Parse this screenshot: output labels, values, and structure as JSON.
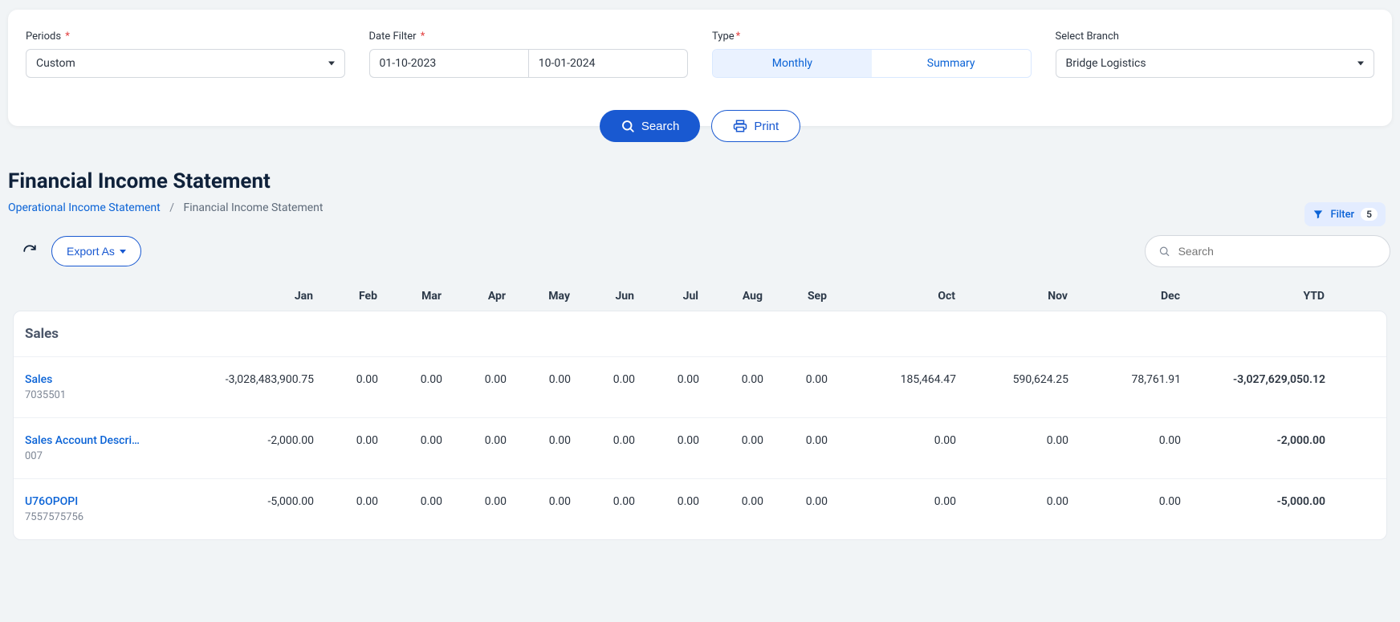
{
  "filters": {
    "periods_label": "Periods",
    "periods_value": "Custom",
    "date_filter_label": "Date Filter",
    "date_from": "01-10-2023",
    "date_to": "10-01-2024",
    "type_label": "Type",
    "type_options": [
      "Monthly",
      "Summary"
    ],
    "type_selected": "Monthly",
    "branch_label": "Select Branch",
    "branch_value": "Bridge Logistics",
    "required_marker": "*"
  },
  "actions": {
    "search_label": "Search",
    "print_label": "Print"
  },
  "page": {
    "title": "Financial Income Statement",
    "breadcrumb_link": "Operational Income Statement",
    "breadcrumb_sep": "/",
    "breadcrumb_current": "Financial Income Statement",
    "filter_chip_label": "Filter",
    "filter_chip_count": "5",
    "export_label": "Export As",
    "search_placeholder": "Search"
  },
  "table": {
    "columns": [
      "",
      "Jan",
      "Feb",
      "Mar",
      "Apr",
      "May",
      "Jun",
      "Jul",
      "Aug",
      "Sep",
      "Oct",
      "Nov",
      "Dec",
      "YTD"
    ],
    "section_title": "Sales",
    "rows": [
      {
        "name": "Sales",
        "code": "7035501",
        "vals": [
          "-3,028,483,900.75",
          "0.00",
          "0.00",
          "0.00",
          "0.00",
          "0.00",
          "0.00",
          "0.00",
          "0.00",
          "185,464.47",
          "590,624.25",
          "78,761.91",
          "-3,027,629,050.12"
        ]
      },
      {
        "name": "Sales Account Descri…",
        "code": "007",
        "vals": [
          "-2,000.00",
          "0.00",
          "0.00",
          "0.00",
          "0.00",
          "0.00",
          "0.00",
          "0.00",
          "0.00",
          "0.00",
          "0.00",
          "0.00",
          "-2,000.00"
        ]
      },
      {
        "name": "U76OPOPI",
        "code": "7557575756",
        "vals": [
          "-5,000.00",
          "0.00",
          "0.00",
          "0.00",
          "0.00",
          "0.00",
          "0.00",
          "0.00",
          "0.00",
          "0.00",
          "0.00",
          "0.00",
          "-5,000.00"
        ]
      }
    ]
  }
}
